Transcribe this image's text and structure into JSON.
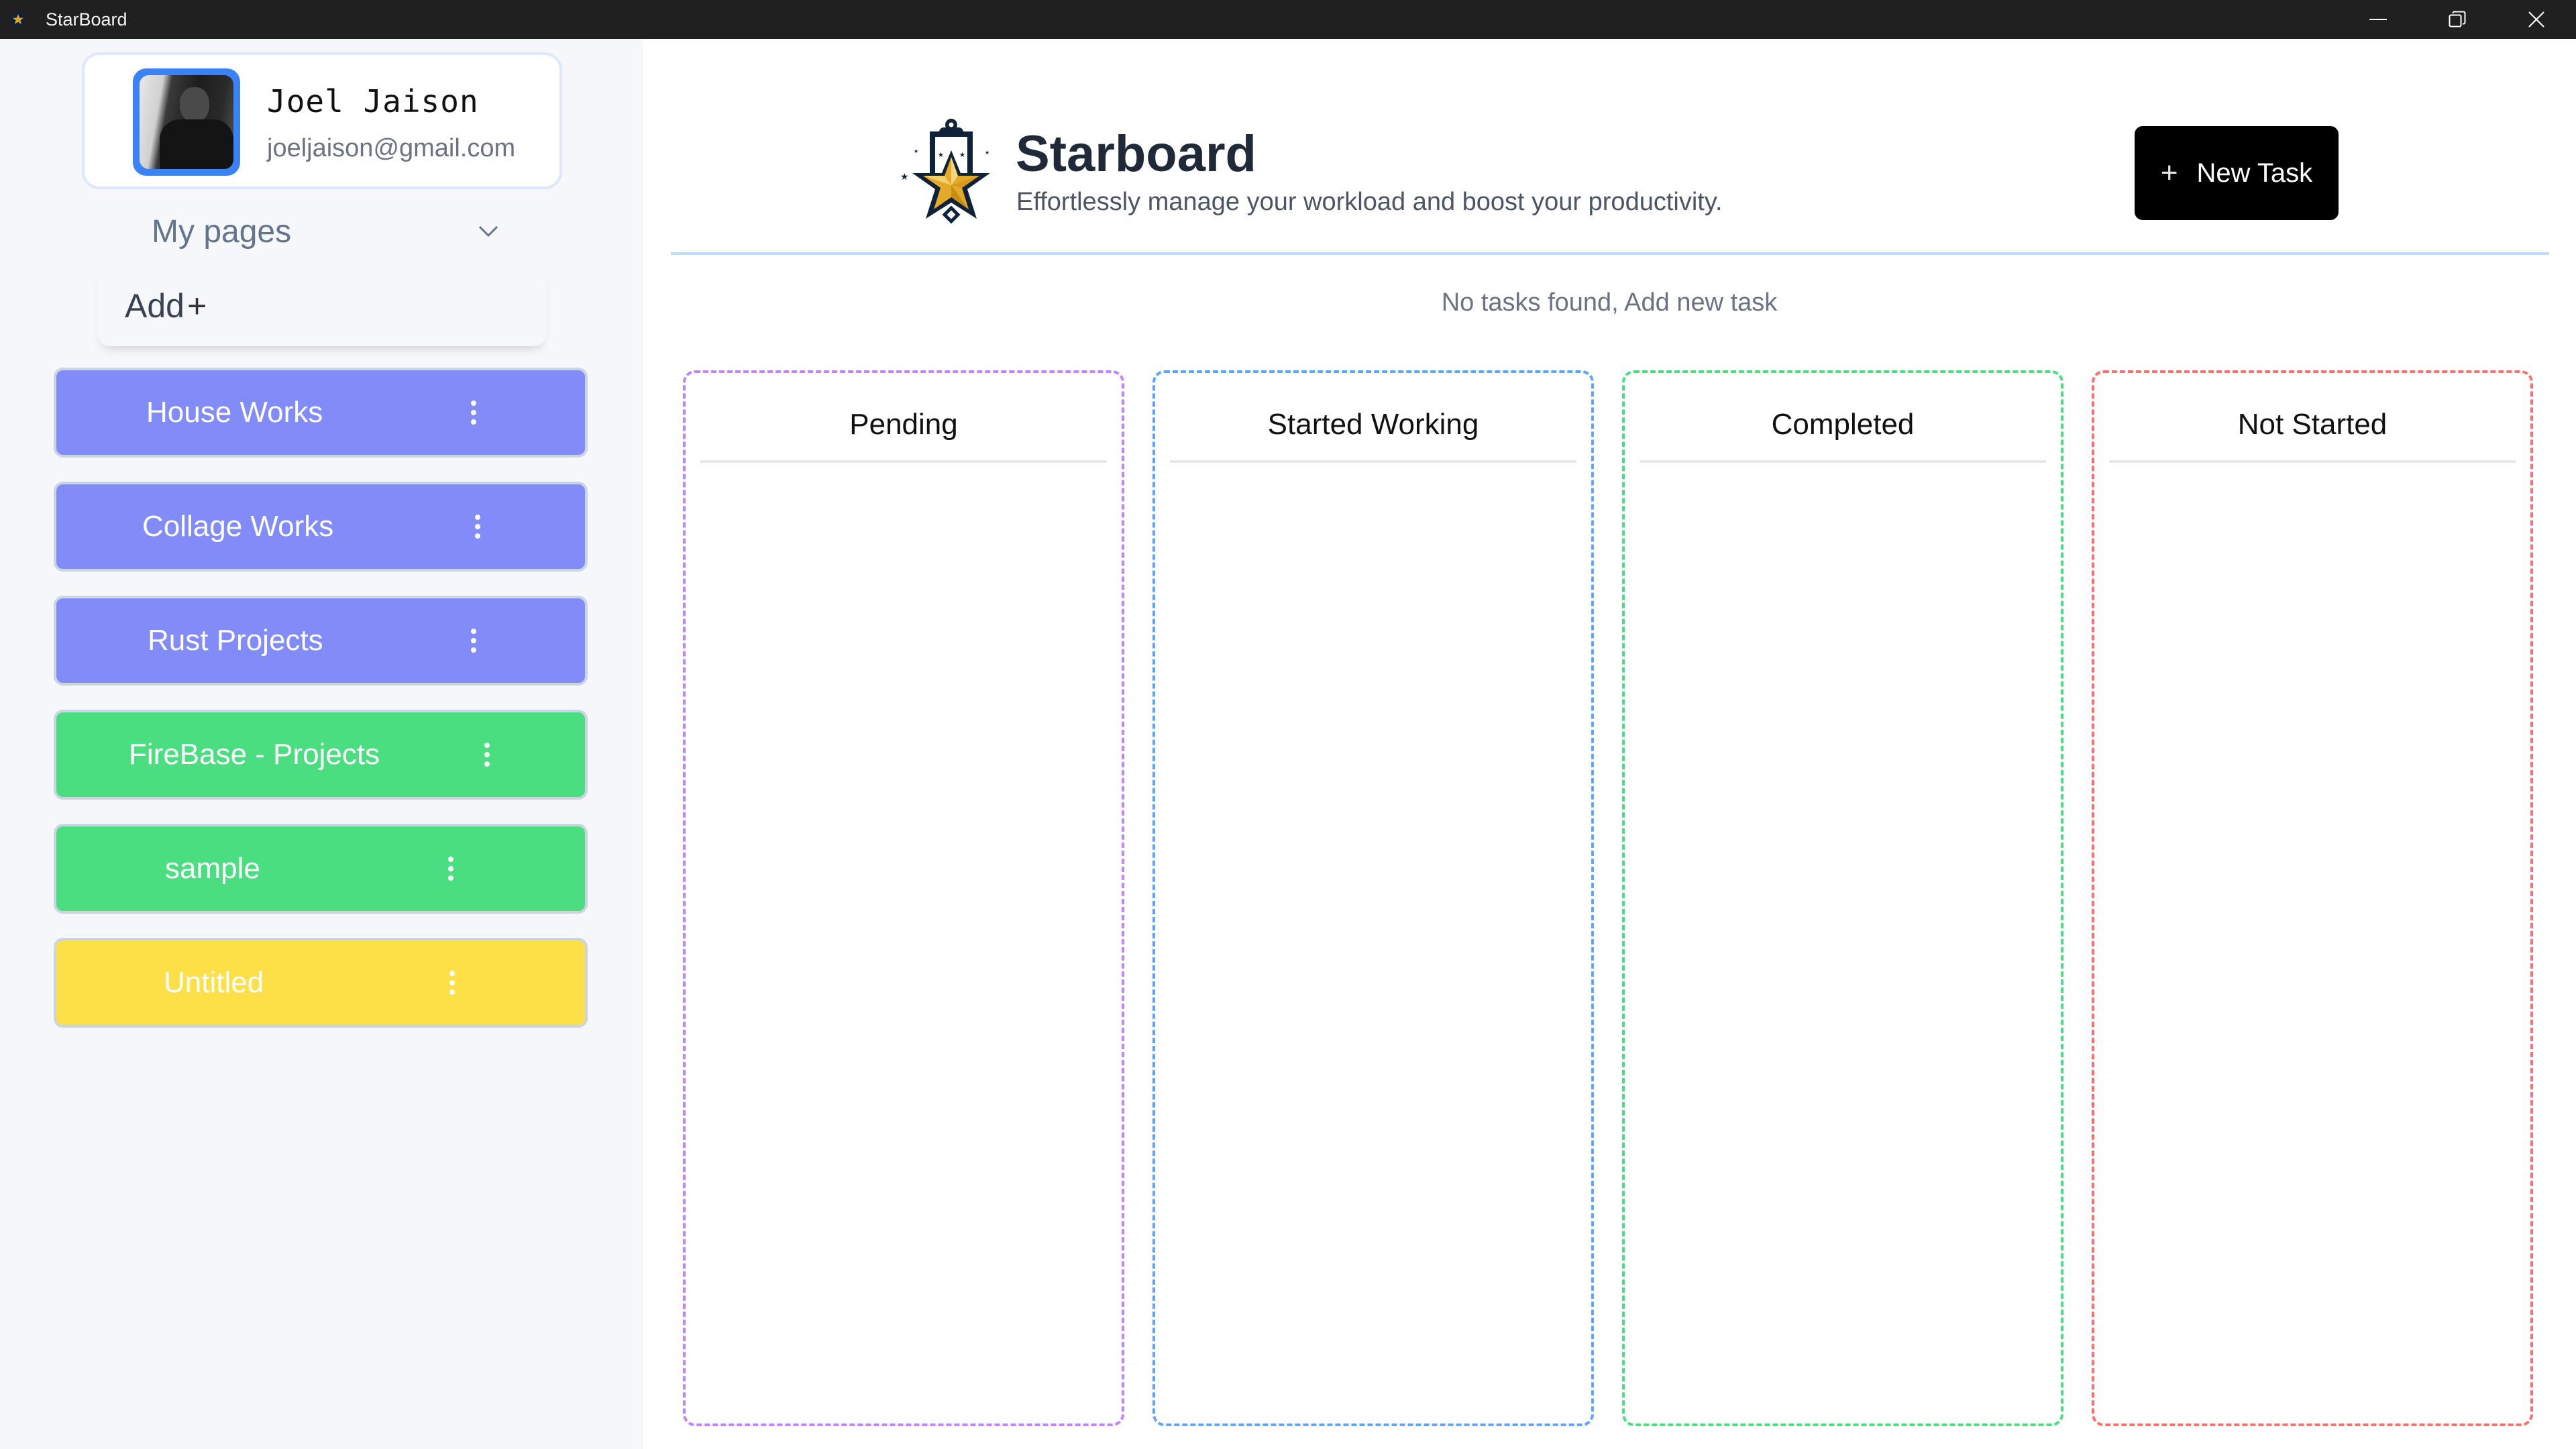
{
  "window": {
    "title": "StarBoard",
    "controls": [
      "minimize",
      "restore",
      "close"
    ]
  },
  "sidebar": {
    "profile": {
      "name": "Joel Jaison",
      "email": "joeljaison@gmail.com",
      "avatar_border_color": "#3B82F6"
    },
    "my_pages_label": "My pages",
    "add_label": "Add",
    "add_icon": "+",
    "pages": [
      {
        "label": "House Works",
        "color": "#818CF8",
        "menu_icon": "more-vertical-icon"
      },
      {
        "label": "Collage Works",
        "color": "#818CF8",
        "menu_icon": "more-vertical-icon"
      },
      {
        "label": "Rust Projects",
        "color": "#818CF8",
        "menu_icon": "more-vertical-icon"
      },
      {
        "label": "FireBase - Projects",
        "color": "#4ADE80",
        "menu_icon": "more-vertical-icon"
      },
      {
        "label": "sample",
        "color": "#4ADE80",
        "menu_icon": "more-vertical-icon"
      },
      {
        "label": "Untitled",
        "color": "#FDE047",
        "menu_icon": "more-vertical-icon"
      }
    ]
  },
  "header": {
    "brand_title": "Starboard",
    "brand_subtitle": "Effortlessly manage your workload and boost your productivity.",
    "new_task_icon": "+",
    "new_task_label": "New Task"
  },
  "board": {
    "empty_message": "No tasks found, Add new task",
    "columns": [
      {
        "title": "Pending",
        "border_color": "#C084FC",
        "tasks": []
      },
      {
        "title": "Started Working",
        "border_color": "#60A5FA",
        "tasks": []
      },
      {
        "title": "Completed",
        "border_color": "#4ADE80",
        "tasks": []
      },
      {
        "title": "Not Started",
        "border_color": "#F87171",
        "tasks": []
      }
    ]
  }
}
